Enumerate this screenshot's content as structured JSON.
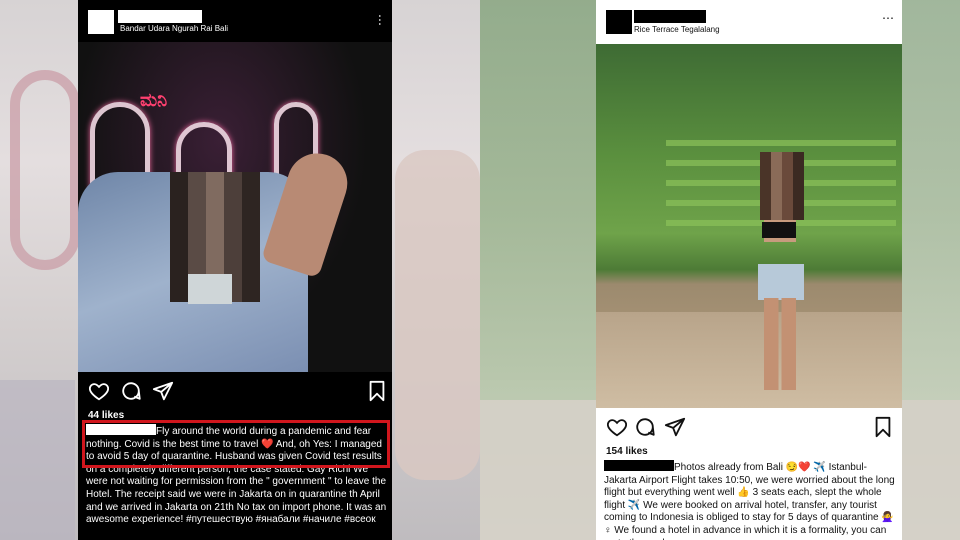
{
  "left_post": {
    "location": "Bandar Udara Ngurah Rai Bali",
    "more_icon": "⋯",
    "photo_sign_text": "ಮನಿ",
    "likes": "44 likes",
    "caption": "Fly around the world during a pandemic and fear nothing. Covid is the best time to travel ❤️ And, oh Yes: I managed to avoid 5 day of quarantine. Husband was given Covid test results on a completely different person, the case stated: Gay Richi We were not waiting for permission from the \" government \" to leave the Hotel. The receipt said we were in Jakarta on in quarantine th April and we arrived in Jakarta on 21th No tax on import phone. It was an awesome experience! #путешествую #янабали #начиле #всеок"
  },
  "right_post": {
    "location": "Rice Terrace Tegalalang",
    "more_icon": "⋯",
    "likes": "154 likes",
    "caption": "Photos already from Bali 😏❤️ ✈️ Istanbul-Jakarta Airport Flight takes 10:50, we were worried about the long flight but everything went well 👍 3 seats each, slept the whole flight ✈️ We were booked on arrival hotel, transfer, any tourist coming to Indonesia is obliged to stay for 5 days of quarantine 🙅‍♀️ ♀ We found a hotel in advance in which it is a formality, you can go to the pool"
  },
  "colors": {
    "highlight": "#d1161d",
    "left_bg": "#000000",
    "right_bg": "#ffffff"
  },
  "icons": [
    "heart-icon",
    "comment-icon",
    "share-icon",
    "bookmark-icon",
    "more-icon"
  ]
}
